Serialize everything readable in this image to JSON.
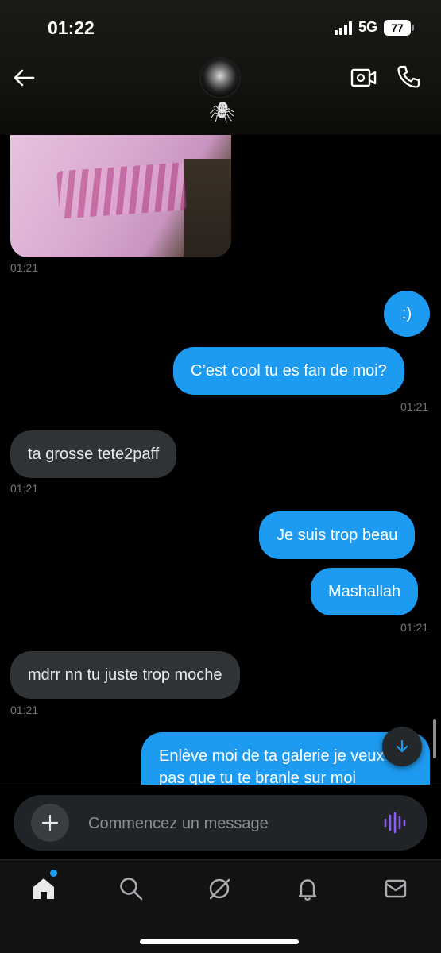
{
  "status_bar": {
    "time": "01:22",
    "network": "5G",
    "battery": "77"
  },
  "header": {
    "avatar_icon": "profile-avatar",
    "emoji": "🕷"
  },
  "chat": {
    "image_time": "01:21",
    "messages": [
      {
        "dir": "out",
        "text": ":)",
        "time": ""
      },
      {
        "dir": "out",
        "text": "C’est cool tu es fan de moi?",
        "time": "01:21"
      },
      {
        "dir": "in",
        "text": "ta grosse tete2paff",
        "time": "01:21"
      },
      {
        "dir": "out",
        "text": "Je suis trop beau",
        "time": ""
      },
      {
        "dir": "out",
        "text": "Mashallah",
        "time": "01:21"
      },
      {
        "dir": "in",
        "text": "mdrr nn tu juste trop moche",
        "time": "01:21"
      },
      {
        "dir": "out",
        "text_line1": "Enlève moi de ta galerie je veux",
        "text_line2": "pas que tu te branle sur moi",
        "time": ""
      }
    ]
  },
  "composer": {
    "placeholder": "Commencez un message"
  },
  "colors": {
    "accent": "#1d9bf0",
    "incoming_bubble": "#2f3336",
    "voice_icon": "#8c5cf6"
  },
  "tabs": [
    "home-icon",
    "search-icon",
    "grok-icon",
    "notifications-icon",
    "messages-icon"
  ]
}
